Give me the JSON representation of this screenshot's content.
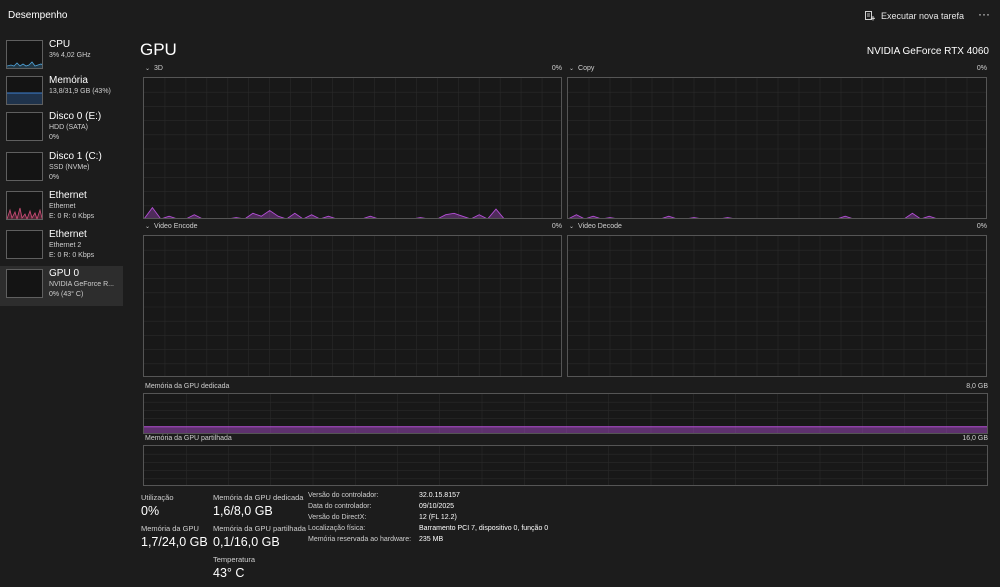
{
  "header": {
    "title": "Desempenho",
    "run_task_label": "Executar nova tarefa",
    "more_label": "···"
  },
  "sidebar": {
    "items": [
      {
        "name": "CPU",
        "line1": "3% 4,02 GHz",
        "line2": ""
      },
      {
        "name": "Memória",
        "line1": "13,8/31,9 GB (43%)",
        "line2": ""
      },
      {
        "name": "Disco 0 (E:)",
        "line1": "HDD (SATA)",
        "line2": "0%"
      },
      {
        "name": "Disco 1 (C:)",
        "line1": "SSD (NVMe)",
        "line2": "0%"
      },
      {
        "name": "Ethernet",
        "line1": "Ethernet",
        "line2": "E: 0 R: 0 Kbps"
      },
      {
        "name": "Ethernet",
        "line1": "Ethernet 2",
        "line2": "E: 0 R: 0 Kbps"
      },
      {
        "name": "GPU 0",
        "line1": "NVIDIA GeForce R...",
        "line2": "0% (43° C)"
      }
    ]
  },
  "main": {
    "title": "GPU",
    "device": "NVIDIA GeForce RTX 4060",
    "engines": [
      {
        "label": "3D",
        "value": "0%"
      },
      {
        "label": "Copy",
        "value": "0%"
      },
      {
        "label": "Video Encode",
        "value": "0%"
      },
      {
        "label": "Video Decode",
        "value": "0%"
      }
    ],
    "dedicated": {
      "label": "Memória da GPU dedicada",
      "max": "8,0 GB"
    },
    "shared": {
      "label": "Memória da GPU partilhada",
      "max": "16,0 GB"
    },
    "stats": {
      "utilization": {
        "label": "Utilização",
        "value": "0%"
      },
      "gpu_memory": {
        "label": "Memória da GPU",
        "value": "1,7/24,0 GB"
      },
      "dedicated_mem": {
        "label": "Memória da GPU dedicada",
        "value": "1,6/8,0 GB"
      },
      "shared_mem": {
        "label": "Memória da GPU partilhada",
        "value": "0,1/16,0 GB"
      },
      "temperature": {
        "label": "Temperatura",
        "value": "43° C"
      }
    },
    "details": [
      {
        "label": "Versão do controlador:",
        "value": "32.0.15.8157"
      },
      {
        "label": "Data do controlador:",
        "value": "09/10/2025"
      },
      {
        "label": "Versão do DirectX:",
        "value": "12 (FL 12.2)"
      },
      {
        "label": "Localização física:",
        "value": "Barramento PCI 7, dispositivo 0, função 0"
      },
      {
        "label": "Memória reservada ao hardware:",
        "value": "235 MB"
      }
    ]
  },
  "colors": {
    "gpu_accent": "#b44fd6",
    "cpu_accent": "#4fa3d9",
    "memory_accent": "#3d7fd1",
    "ethernet_accent": "#d14f7a",
    "background": "#1c1c1c",
    "graph_border": "#555555",
    "grid": "#2a2a2a"
  },
  "graphs": {
    "engine_3d": [
      0,
      0.08,
      0,
      0.02,
      0,
      0,
      0.03,
      0,
      0,
      0,
      0,
      0.01,
      0,
      0.04,
      0.02,
      0.06,
      0.02,
      0,
      0.04,
      0,
      0.03,
      0,
      0.02,
      0,
      0,
      0,
      0,
      0.02,
      0,
      0,
      0,
      0,
      0,
      0.01,
      0,
      0,
      0.03,
      0.04,
      0.02,
      0,
      0.03,
      0,
      0.07,
      0,
      0,
      0,
      0,
      0,
      0,
      0,
      0
    ],
    "engine_copy": [
      0,
      0.03,
      0,
      0.02,
      0,
      0.01,
      0,
      0,
      0,
      0,
      0,
      0,
      0.02,
      0,
      0,
      0.01,
      0,
      0,
      0,
      0.01,
      0,
      0,
      0,
      0,
      0,
      0,
      0,
      0,
      0,
      0,
      0,
      0,
      0,
      0.02,
      0,
      0,
      0,
      0,
      0,
      0,
      0,
      0.04,
      0,
      0.02,
      0,
      0,
      0,
      0,
      0,
      0,
      0
    ],
    "engine_encode": [],
    "engine_decode": [],
    "dedicated_level": 0.2,
    "shared_level": 0.006
  }
}
